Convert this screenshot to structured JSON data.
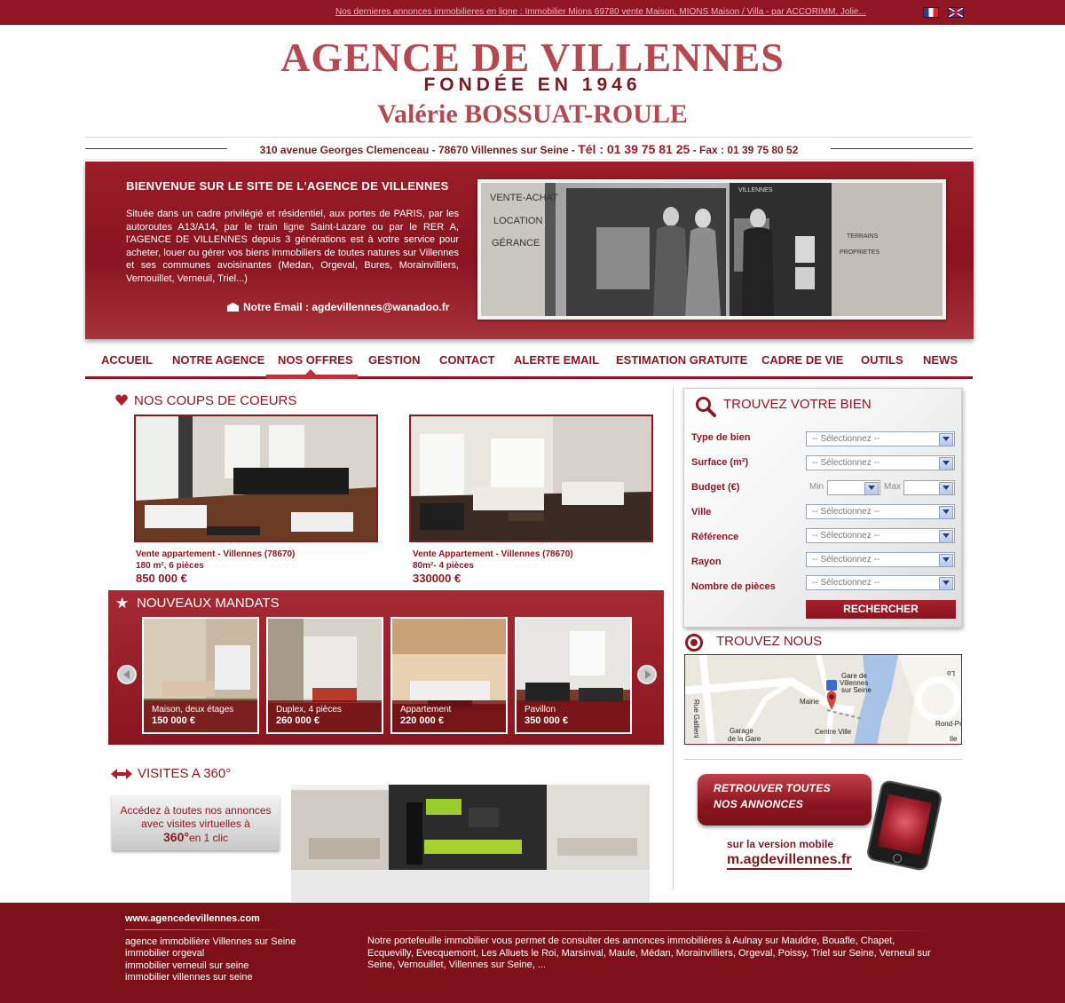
{
  "topbar": {
    "ticker": "Nos dernieres annonces immobilieres en ligne :  Immobilier Mions 69780 vente Maison, MIONS Maison / Villa - par ACCORIMM,  Jolie...",
    "flag_fr": "flag-fr-icon",
    "flag_en": "flag-uk-icon"
  },
  "brand": {
    "title": "AGENCE DE VILLENNES",
    "founded": "FONDÉE EN 1946",
    "owner": "Valérie BOSSUAT-ROULE"
  },
  "contact": {
    "address": "310 avenue Georges Clemenceau  -  78670 Villennes sur Seine  -",
    "tel": "Tél : 01 39 75 81 25",
    "fax": "-  Fax : 01 39 75 80 52"
  },
  "hero": {
    "heading": "BIENVENUE SUR LE SITE DE L'AGENCE DE VILLENNES",
    "text": "Située dans un cadre privilégié et résidentiel, aux portes de PARIS, par les autoroutes A13/A14, par le train ligne Saint-Lazare ou par le RER A, l'AGENCE DE VILLENNES depuis 3 générations est à votre service pour acheter, louer ou gérer vos biens immobiliers de toutes natures sur Villennes et ses communes avoisinantes (Medan, Orgeval, Bures, Morainvilliers, Vernouillet, Verneuil, Triel...)",
    "email": "Notre Email : agdevillennes@wanadoo.fr",
    "photo_texts": [
      "VENTE-ACHAT",
      "LOCATION",
      "GÉRANCE",
      "VILLENNES",
      "TERRAINS",
      "PROPRIETES"
    ]
  },
  "nav": {
    "items": [
      "ACCUEIL",
      "NOTRE AGENCE",
      "NOS OFFRES",
      "GESTION",
      "CONTACT",
      "ALERTE EMAIL",
      "ESTIMATION GRATUITE",
      "CADRE DE VIE",
      "OUTILS",
      "NEWS"
    ],
    "active": "NOS OFFRES"
  },
  "coups": {
    "title": "NOS COUPS DE COEURS",
    "items": [
      {
        "title": "Vente appartement -  Villennes (78670)",
        "sub": "180 m², 6 pièces",
        "price": "850 000 €"
      },
      {
        "title": "Vente Appartement - Villennes (78670)",
        "sub": "80m²- 4 pièces",
        "price": "330000 €"
      }
    ]
  },
  "mandats": {
    "title": "NOUVEAUX MANDATS",
    "items": [
      {
        "type": "Maison, deux étages",
        "price": "150 000 €"
      },
      {
        "type": "Duplex, 4 pièces",
        "price": "260 000 €"
      },
      {
        "type": "Appartement",
        "price": "220 000 €"
      },
      {
        "type": "Pavillon",
        "price": "350 000 €"
      }
    ]
  },
  "visites": {
    "title": "VISITES A 360°",
    "line1": "Accédez à toutes nos annonces",
    "line2": "avec visites virtuelles à",
    "big": "360°",
    "line3": "en 1 clic"
  },
  "search": {
    "title": "TROUVEZ VOTRE BIEN",
    "placeholder": "-- Sélectionnez --",
    "fields": [
      "Type de bien",
      "Surface (m²)",
      "Budget (€)",
      "Ville",
      "Référence",
      "Rayon",
      "Nombre de pièces"
    ],
    "min_label": "Min",
    "max_label": "Max",
    "button": "RECHERCHER"
  },
  "find_us": {
    "title": "TROUVEZ NOUS",
    "map_labels": [
      "Gare de",
      "Villennes",
      "sur Seine",
      "Mairie",
      "Rue Gallieni",
      "Garage",
      "de la Gare",
      "Centre Ville",
      "Rond-Po",
      "Ile",
      "Lo"
    ]
  },
  "promo": {
    "line1": "RETROUVER TOUTES",
    "line2": "NOS ANNONCES",
    "sub": "sur la version mobile",
    "url": "m.agdevillennes.fr"
  },
  "footer": {
    "site": "www.agencedevillennes.com",
    "links": [
      "agence immobilière Villennes sur Seine",
      "immobilier orgeval",
      "immobilier verneuil sur seine",
      "immobilier villennes sur seine"
    ],
    "text": "Notre portefeuille immobilier vous permet de consulter des annonces immobilières à Aulnay sur Mauldre, Bouafle, Chapet, Ecquevilly, Evecquemont, Les Alluets le Roi, Marsinval, Maule, Médan, Morainvilliers, Orgeval, Poissy, Triel sur Seine, Verneuil sur Seine, Vernouillet, Villennes sur Seine, ..."
  },
  "colors": {
    "brand": "#8f1622",
    "logo": "#b5494f"
  }
}
